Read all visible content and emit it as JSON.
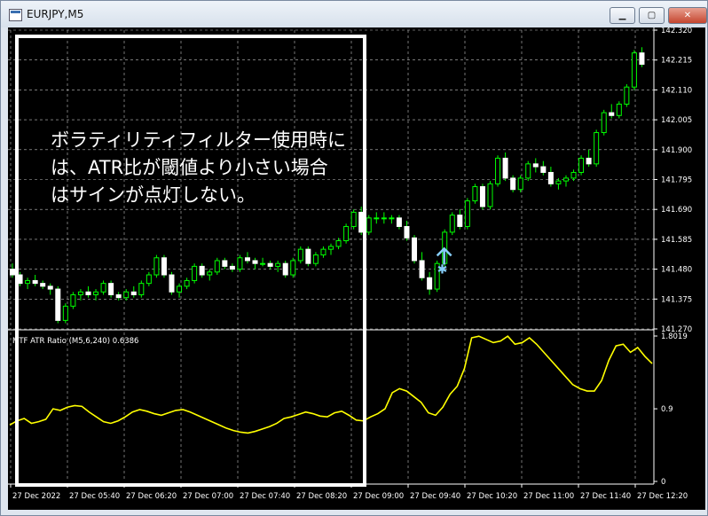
{
  "window": {
    "title": "EURJPY,M5",
    "minimize": "▁",
    "maximize": "▢",
    "close": "✕"
  },
  "price_axis": {
    "ticks": [
      "142.320",
      "142.215",
      "142.110",
      "142.005",
      "141.900",
      "141.795",
      "141.690",
      "141.585",
      "141.480",
      "141.375",
      "141.270"
    ]
  },
  "indicator": {
    "label": "MTF ATR Ratio (M5,6,240) 0.6386",
    "ticks": [
      "1.8019",
      "0.9",
      "0"
    ]
  },
  "time_axis": {
    "ticks": [
      "27 Dec 2022",
      "27 Dec 05:40",
      "27 Dec 06:20",
      "27 Dec 07:00",
      "27 Dec 07:40",
      "27 Dec 08:20",
      "27 Dec 09:00",
      "27 Dec 09:40",
      "27 Dec 10:20",
      "27 Dec 11:00",
      "27 Dec 11:40",
      "27 Dec 12:20"
    ]
  },
  "annotation": {
    "line1": "ボラティリティフィルター使用時に",
    "line2": "は、ATR比が閾値より小さい場合",
    "line3": "はサインが点灯しない。"
  },
  "colors": {
    "bull": "#00ff00",
    "bear": "#ffffff",
    "ind_line": "#ffff00",
    "arrow": "#87cefa",
    "grid": "#c0c0c0"
  },
  "chart_data": {
    "type": "candlestick",
    "ylim": [
      141.27,
      142.32
    ],
    "candles": [
      [
        141.48,
        141.5,
        141.45,
        141.46
      ],
      [
        141.46,
        141.47,
        141.42,
        141.43
      ],
      [
        141.43,
        141.45,
        141.41,
        141.44
      ],
      [
        141.44,
        141.46,
        141.42,
        141.43
      ],
      [
        141.43,
        141.44,
        141.41,
        141.42
      ],
      [
        141.42,
        141.43,
        141.39,
        141.41
      ],
      [
        141.41,
        141.42,
        141.29,
        141.3
      ],
      [
        141.3,
        141.36,
        141.29,
        141.35
      ],
      [
        141.35,
        141.4,
        141.34,
        141.39
      ],
      [
        141.39,
        141.41,
        141.37,
        141.4
      ],
      [
        141.4,
        141.42,
        141.38,
        141.39
      ],
      [
        141.39,
        141.41,
        141.37,
        141.4
      ],
      [
        141.4,
        141.44,
        141.39,
        141.43
      ],
      [
        141.43,
        141.44,
        141.38,
        141.39
      ],
      [
        141.39,
        141.4,
        141.37,
        141.38
      ],
      [
        141.38,
        141.41,
        141.37,
        141.4
      ],
      [
        141.4,
        141.42,
        141.38,
        141.39
      ],
      [
        141.39,
        141.44,
        141.38,
        141.43
      ],
      [
        141.43,
        141.47,
        141.42,
        141.46
      ],
      [
        141.46,
        141.53,
        141.45,
        141.52
      ],
      [
        141.52,
        141.53,
        141.45,
        141.46
      ],
      [
        141.46,
        141.47,
        141.39,
        141.4
      ],
      [
        141.4,
        141.43,
        141.38,
        141.42
      ],
      [
        141.42,
        141.45,
        141.41,
        141.44
      ],
      [
        141.44,
        141.5,
        141.43,
        141.49
      ],
      [
        141.49,
        141.5,
        141.45,
        141.46
      ],
      [
        141.46,
        141.48,
        141.44,
        141.47
      ],
      [
        141.47,
        141.52,
        141.46,
        141.51
      ],
      [
        141.51,
        141.52,
        141.48,
        141.49
      ],
      [
        141.49,
        141.5,
        141.47,
        141.48
      ],
      [
        141.48,
        141.53,
        141.47,
        141.52
      ],
      [
        141.52,
        141.54,
        141.5,
        141.51
      ],
      [
        141.51,
        141.52,
        141.48,
        141.5
      ],
      [
        141.5,
        141.52,
        141.49,
        141.5
      ],
      [
        141.5,
        141.51,
        141.48,
        141.49
      ],
      [
        141.49,
        141.51,
        141.47,
        141.5
      ],
      [
        141.5,
        141.51,
        141.45,
        141.46
      ],
      [
        141.46,
        141.52,
        141.45,
        141.51
      ],
      [
        141.51,
        141.56,
        141.5,
        141.55
      ],
      [
        141.55,
        141.56,
        141.49,
        141.5
      ],
      [
        141.5,
        141.54,
        141.49,
        141.53
      ],
      [
        141.53,
        141.56,
        141.52,
        141.55
      ],
      [
        141.55,
        141.57,
        141.53,
        141.56
      ],
      [
        141.56,
        141.59,
        141.55,
        141.58
      ],
      [
        141.58,
        141.64,
        141.57,
        141.63
      ],
      [
        141.63,
        141.69,
        141.62,
        141.68
      ],
      [
        141.68,
        141.7,
        141.6,
        141.61
      ],
      [
        141.61,
        141.67,
        141.6,
        141.66
      ],
      [
        141.66,
        141.68,
        141.64,
        141.66
      ],
      [
        141.66,
        141.68,
        141.64,
        141.66
      ],
      [
        141.66,
        141.67,
        141.64,
        141.66
      ],
      [
        141.66,
        141.67,
        141.62,
        141.63
      ],
      [
        141.63,
        141.65,
        141.58,
        141.59
      ],
      [
        141.59,
        141.6,
        141.5,
        141.51
      ],
      [
        141.51,
        141.54,
        141.44,
        141.45
      ],
      [
        141.45,
        141.47,
        141.39,
        141.41
      ],
      [
        141.41,
        141.51,
        141.4,
        141.5
      ],
      [
        141.5,
        141.62,
        141.49,
        141.61
      ],
      [
        141.61,
        141.68,
        141.6,
        141.67
      ],
      [
        141.67,
        141.69,
        141.62,
        141.63
      ],
      [
        141.63,
        141.73,
        141.62,
        141.72
      ],
      [
        141.72,
        141.78,
        141.71,
        141.77
      ],
      [
        141.77,
        141.78,
        141.69,
        141.7
      ],
      [
        141.7,
        141.79,
        141.69,
        141.78
      ],
      [
        141.78,
        141.88,
        141.77,
        141.87
      ],
      [
        141.87,
        141.89,
        141.79,
        141.8
      ],
      [
        141.8,
        141.81,
        141.75,
        141.76
      ],
      [
        141.76,
        141.81,
        141.75,
        141.8
      ],
      [
        141.8,
        141.86,
        141.79,
        141.85
      ],
      [
        141.85,
        141.87,
        141.82,
        141.84
      ],
      [
        141.84,
        141.86,
        141.81,
        141.82
      ],
      [
        141.82,
        141.84,
        141.77,
        141.78
      ],
      [
        141.78,
        141.8,
        141.76,
        141.79
      ],
      [
        141.79,
        141.81,
        141.77,
        141.8
      ],
      [
        141.8,
        141.83,
        141.79,
        141.82
      ],
      [
        141.82,
        141.88,
        141.81,
        141.87
      ],
      [
        141.87,
        141.9,
        141.84,
        141.85
      ],
      [
        141.85,
        141.97,
        141.84,
        141.96
      ],
      [
        141.96,
        142.04,
        141.95,
        142.03
      ],
      [
        142.03,
        142.06,
        142.01,
        142.02
      ],
      [
        142.02,
        142.07,
        142.01,
        142.06
      ],
      [
        142.06,
        142.13,
        142.05,
        142.12
      ],
      [
        142.12,
        142.25,
        142.11,
        142.24
      ],
      [
        142.24,
        142.26,
        142.19,
        142.2
      ]
    ],
    "atr_ratio": [
      0.7,
      0.75,
      0.78,
      0.72,
      0.74,
      0.77,
      0.9,
      0.88,
      0.92,
      0.94,
      0.93,
      0.86,
      0.8,
      0.74,
      0.72,
      0.75,
      0.8,
      0.86,
      0.89,
      0.87,
      0.84,
      0.82,
      0.85,
      0.88,
      0.89,
      0.86,
      0.82,
      0.78,
      0.74,
      0.7,
      0.66,
      0.63,
      0.61,
      0.6,
      0.62,
      0.65,
      0.68,
      0.72,
      0.78,
      0.8,
      0.83,
      0.86,
      0.84,
      0.81,
      0.8,
      0.85,
      0.87,
      0.82,
      0.76,
      0.75,
      0.8,
      0.84,
      0.9,
      1.1,
      1.15,
      1.12,
      1.05,
      0.98,
      0.85,
      0.82,
      0.92,
      1.08,
      1.18,
      1.4,
      1.78,
      1.8,
      1.76,
      1.72,
      1.74,
      1.8,
      1.7,
      1.72,
      1.78,
      1.7,
      1.6,
      1.5,
      1.4,
      1.3,
      1.2,
      1.15,
      1.12,
      1.12,
      1.25,
      1.5,
      1.68,
      1.7,
      1.6,
      1.66,
      1.55,
      1.46
    ],
    "signal_index": 56,
    "signal_price": 141.49
  }
}
